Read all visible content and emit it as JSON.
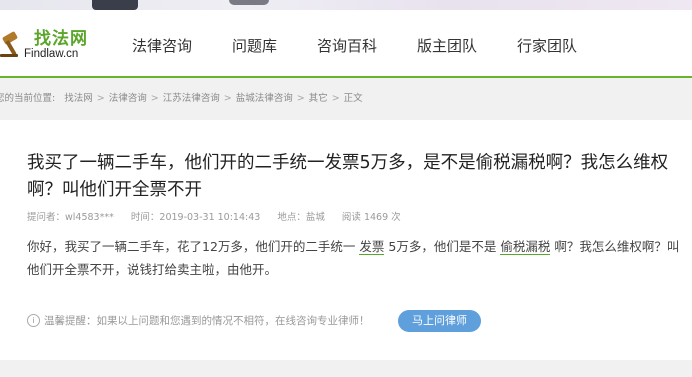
{
  "logo": {
    "name_cn": "找法网",
    "name_en": "Findlaw.cn"
  },
  "nav": {
    "items": [
      "法律咨询",
      "问题库",
      "咨询百科",
      "版主团队",
      "行家团队"
    ]
  },
  "breadcrumb": {
    "prefix": "您的当前位置:",
    "items": [
      "找法网",
      "法律咨询",
      "江苏法律咨询",
      "盐城法律咨询",
      "其它",
      "正文"
    ],
    "separator": ">"
  },
  "question": {
    "title": "我买了一辆二手车，他们开的二手统一发票5万多，是不是偷税漏税啊？我怎么维权啊？叫他们开全票不开",
    "asker_label": "提问者：",
    "asker": "wl4583***",
    "time_label": "时间：",
    "time": "2019-03-31 10:14:43",
    "location_label": "地点：",
    "location": "盐城",
    "views_label": "阅读",
    "views": "1469",
    "views_unit": "次",
    "body_1": "你好，我买了一辆二手车，花了12万多，他们开的二手统一",
    "keyword_1": "发票",
    "body_2": "5万多，他们是不是",
    "keyword_2": "偷税漏税",
    "body_3": "啊？我怎么维权啊？叫他们开全票不开，说钱打给卖主啦，由他开。"
  },
  "tip": {
    "icon": "info-icon",
    "text": "温馨提醒：如果以上问题和您遇到的情况不相符，在线咨询专业律师！",
    "button_label": "马上问律师"
  },
  "colors": {
    "brand_green": "#5aa52a",
    "nav_underline": "#68b52d",
    "button_blue": "#5e9fdc"
  }
}
